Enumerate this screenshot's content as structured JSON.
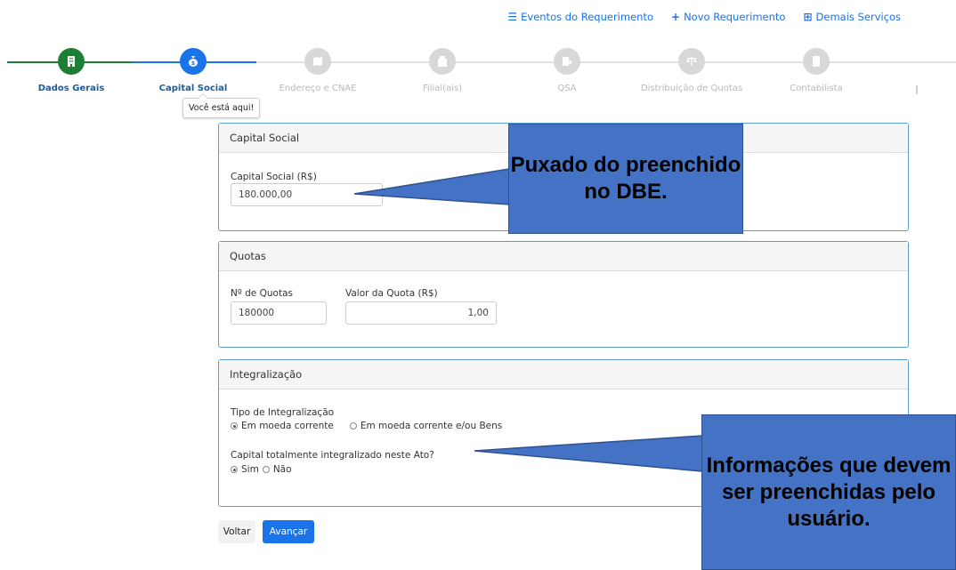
{
  "topnav": {
    "events": "Eventos do Requerimento",
    "new_request": "Novo Requerimento",
    "other_services": "Demais Serviços"
  },
  "stepper": {
    "steps": [
      {
        "label": "Dados Gerais",
        "icon": "building-icon",
        "state": "done"
      },
      {
        "label": "Capital Social",
        "icon": "money-bag-icon",
        "state": "active"
      },
      {
        "label": "Endereço e CNAE",
        "icon": "map-icon",
        "state": "pending"
      },
      {
        "label": "Filial(ais)",
        "icon": "branch-building-icon",
        "state": "pending"
      },
      {
        "label": "QSA",
        "icon": "people-icon",
        "state": "pending"
      },
      {
        "label": "Distribuição de Quotas",
        "icon": "scale-icon",
        "state": "pending"
      },
      {
        "label": "Contabilista",
        "icon": "person-icon",
        "state": "pending"
      }
    ],
    "tooltip": "Você está aqui!"
  },
  "capital": {
    "header": "Capital Social",
    "label": "Capital Social (R$)",
    "value": "180.000,00"
  },
  "quotas": {
    "header": "Quotas",
    "count_label": "Nº de Quotas",
    "count_value": "180000",
    "value_label": "Valor da Quota (R$)",
    "value_value": "1,00"
  },
  "integralization": {
    "header": "Integralização",
    "type_label": "Tipo de Integralização",
    "option1": "Em moeda corrente",
    "option2": "Em moeda corrente e/ou Bens",
    "selected_type": "option1",
    "full_label": "Capital totalmente integralizado neste Ato?",
    "yes": "Sim",
    "no": "Não",
    "selected_full": "yes"
  },
  "buttons": {
    "back": "Voltar",
    "next": "Avançar"
  },
  "callouts": {
    "top": "Puxado do preenchido no DBE.",
    "bottom": "Informações que devem ser preenchidas pelo usuário."
  },
  "colors": {
    "primary": "#1a73e8",
    "done_step": "#1e7e34",
    "pending_step": "#d8d8d8",
    "card_border": "#5b9bd5",
    "callout_fill": "#4472c4"
  }
}
